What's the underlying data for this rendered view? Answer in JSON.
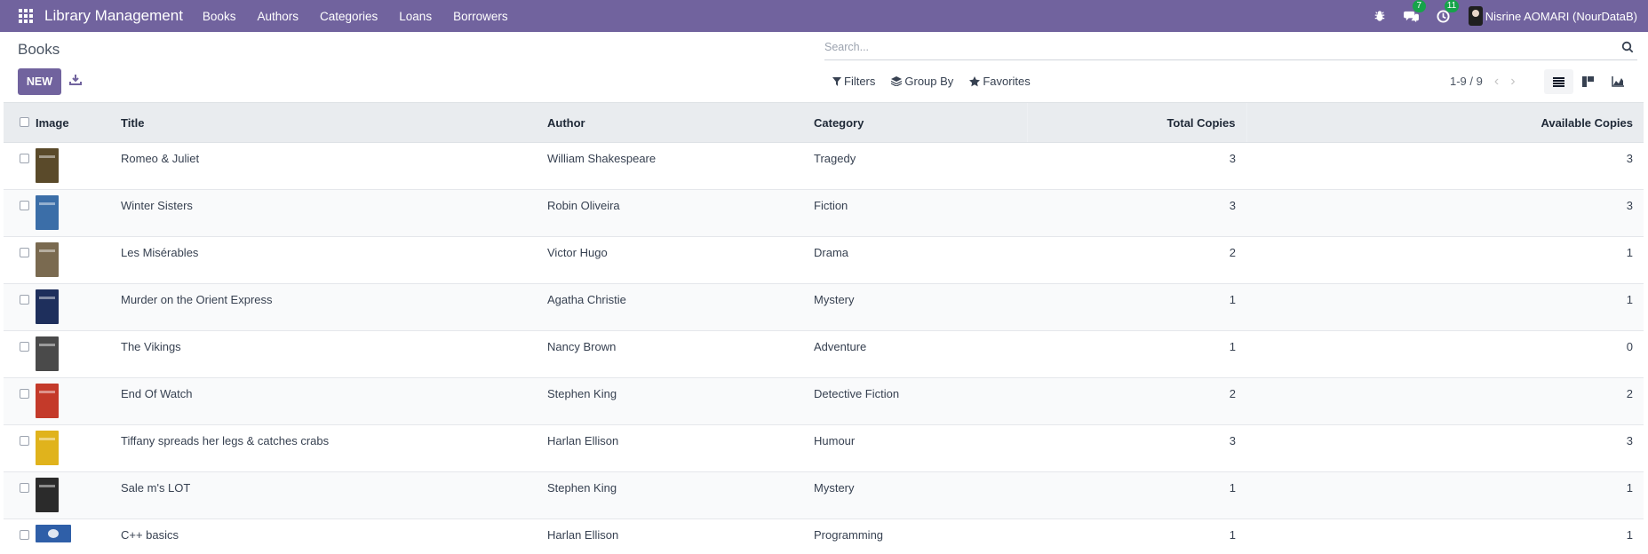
{
  "navbar": {
    "brand": "Library Management",
    "menu": [
      "Books",
      "Authors",
      "Categories",
      "Loans",
      "Borrowers"
    ],
    "messages_count": "7",
    "activities_count": "11",
    "user_name": "Nisrine AOMARI (NourDataB)"
  },
  "control_panel": {
    "title": "Books",
    "new_label": "NEW",
    "search_placeholder": "Search...",
    "filters_label": "Filters",
    "group_by_label": "Group By",
    "favorites_label": "Favorites",
    "pager_value": "1-9 / 9"
  },
  "table": {
    "columns": [
      "Image",
      "Title",
      "Author",
      "Category",
      "Total Copies",
      "Available Copies"
    ],
    "rows": [
      {
        "title": "Romeo & Juliet",
        "author": "William Shakespeare",
        "category": "Tragedy",
        "total": "3",
        "available": "3",
        "cover_color": "#5a4a2a"
      },
      {
        "title": "Winter Sisters",
        "author": "Robin Oliveira",
        "category": "Fiction",
        "total": "3",
        "available": "3",
        "cover_color": "#3b6ea8"
      },
      {
        "title": "Les Misérables",
        "author": "Victor Hugo",
        "category": "Drama",
        "total": "2",
        "available": "1",
        "cover_color": "#7a6a50"
      },
      {
        "title": "Murder on the Orient Express",
        "author": "Agatha Christie",
        "category": "Mystery",
        "total": "1",
        "available": "1",
        "cover_color": "#1e2f5c"
      },
      {
        "title": "The Vikings",
        "author": "Nancy Brown",
        "category": "Adventure",
        "total": "1",
        "available": "0",
        "cover_color": "#4a4a4a"
      },
      {
        "title": "End Of Watch",
        "author": "Stephen King",
        "category": "Detective Fiction",
        "total": "2",
        "available": "2",
        "cover_color": "#c43a2a"
      },
      {
        "title": "Tiffany spreads her legs & catches crabs",
        "author": "Harlan Ellison",
        "category": "Humour",
        "total": "3",
        "available": "3",
        "cover_color": "#e0b31c"
      },
      {
        "title": "Sale m's LOT",
        "author": "Stephen King",
        "category": "Mystery",
        "total": "1",
        "available": "1",
        "cover_color": "#2b2b2b"
      },
      {
        "title": "C++ basics",
        "author": "Harlan Ellison",
        "category": "Programming",
        "total": "1",
        "available": "1",
        "cover_color": "#2f5fa8"
      }
    ]
  }
}
